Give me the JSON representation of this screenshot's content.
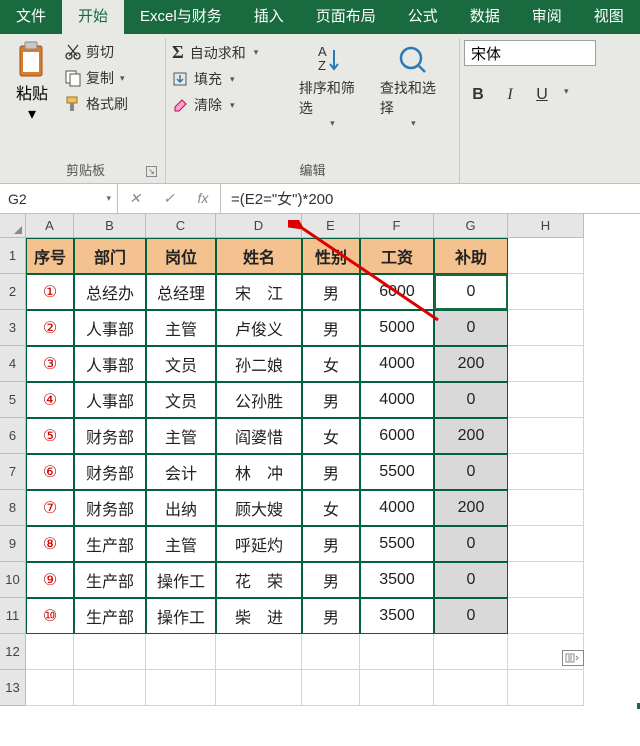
{
  "tabs": [
    "文件",
    "开始",
    "Excel与财务",
    "插入",
    "页面布局",
    "公式",
    "数据",
    "审阅",
    "视图"
  ],
  "active_tab": 1,
  "ribbon": {
    "clipboard": {
      "paste": "粘贴",
      "cut": "剪切",
      "copy": "复制",
      "fmt": "格式刷",
      "label": "剪贴板"
    },
    "editing": {
      "autosum": "自动求和",
      "fill": "填充",
      "clear": "清除",
      "label": "编辑"
    },
    "sortfilter": "排序和筛选",
    "findselect": "查找和选择",
    "font": {
      "name": "宋体",
      "b": "B",
      "i": "I",
      "u": "U"
    }
  },
  "namebox": "G2",
  "formula": "=(E2=\"女\")*200",
  "cols": [
    "A",
    "B",
    "C",
    "D",
    "E",
    "F",
    "G",
    "H"
  ],
  "headers": [
    "序号",
    "部门",
    "岗位",
    "姓名",
    "性别",
    "工资",
    "补助"
  ],
  "rows": [
    {
      "n": "①",
      "dept": "总经办",
      "pos": "总经理",
      "name": "宋　江",
      "sex": "男",
      "sal": "6000",
      "sub": "0",
      "sel": true
    },
    {
      "n": "②",
      "dept": "人事部",
      "pos": "主管",
      "name": "卢俊义",
      "sex": "男",
      "sal": "5000",
      "sub": "0"
    },
    {
      "n": "③",
      "dept": "人事部",
      "pos": "文员",
      "name": "孙二娘",
      "sex": "女",
      "sal": "4000",
      "sub": "200"
    },
    {
      "n": "④",
      "dept": "人事部",
      "pos": "文员",
      "name": "公孙胜",
      "sex": "男",
      "sal": "4000",
      "sub": "0"
    },
    {
      "n": "⑤",
      "dept": "财务部",
      "pos": "主管",
      "name": "阎婆惜",
      "sex": "女",
      "sal": "6000",
      "sub": "200"
    },
    {
      "n": "⑥",
      "dept": "财务部",
      "pos": "会计",
      "name": "林　冲",
      "sex": "男",
      "sal": "5500",
      "sub": "0"
    },
    {
      "n": "⑦",
      "dept": "财务部",
      "pos": "出纳",
      "name": "顾大嫂",
      "sex": "女",
      "sal": "4000",
      "sub": "200"
    },
    {
      "n": "⑧",
      "dept": "生产部",
      "pos": "主管",
      "name": "呼延灼",
      "sex": "男",
      "sal": "5500",
      "sub": "0"
    },
    {
      "n": "⑨",
      "dept": "生产部",
      "pos": "操作工",
      "name": "花　荣",
      "sex": "男",
      "sal": "3500",
      "sub": "0"
    },
    {
      "n": "⑩",
      "dept": "生产部",
      "pos": "操作工",
      "name": "柴　进",
      "sex": "男",
      "sal": "3500",
      "sub": "0"
    }
  ]
}
